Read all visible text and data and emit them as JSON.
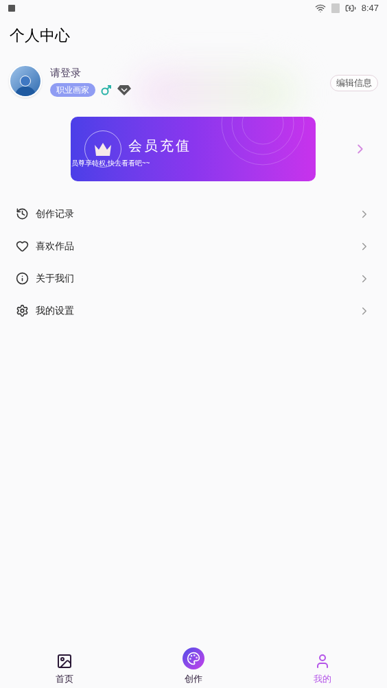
{
  "status_bar": {
    "time": "8:47"
  },
  "title": "个人中心",
  "profile": {
    "name": "请登录",
    "tag": "职业画家",
    "edit_button": "编辑信息"
  },
  "vip_banner": {
    "title": "会员充值",
    "subtitle": "员尊享特权,快去看看吧~~"
  },
  "menu": [
    {
      "kind": "history",
      "label": "创作记录"
    },
    {
      "kind": "heart",
      "label": "喜欢作品"
    },
    {
      "kind": "info",
      "label": "关于我们"
    },
    {
      "kind": "settings",
      "label": "我的设置"
    }
  ],
  "tabs": [
    {
      "kind": "gallery",
      "label": "首页",
      "selected": false
    },
    {
      "kind": "create",
      "label": "创作",
      "selected": false
    },
    {
      "kind": "me",
      "label": "我的",
      "selected": true
    }
  ]
}
